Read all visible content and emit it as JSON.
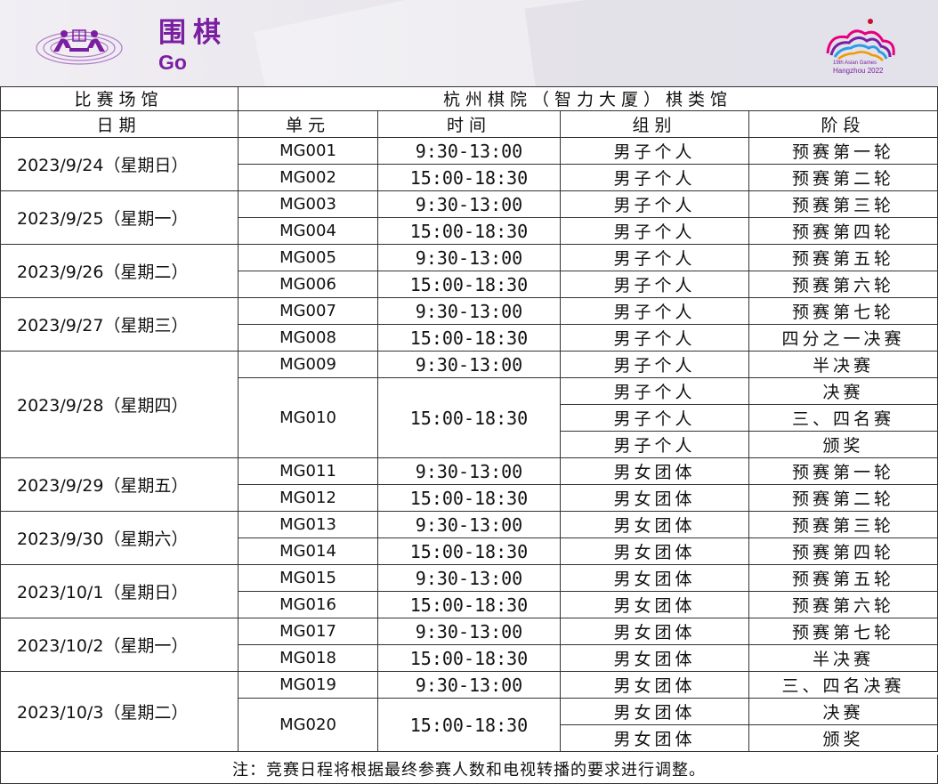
{
  "header": {
    "title_zh": "围棋",
    "title_en": "Go",
    "logo_caption_line1": "19th Asian Games",
    "logo_caption_line2": "Hangzhou 2022"
  },
  "venue": {
    "label": "比赛场馆",
    "name": "杭州棋院（智力大厦）棋类馆"
  },
  "columns": {
    "date": "日期",
    "unit": "单元",
    "time": "时间",
    "group": "组别",
    "phase": "阶段"
  },
  "days": [
    {
      "date": "2023/9/24（星期日）",
      "units": [
        {
          "code": "MG001",
          "time": "9:30-13:00",
          "events": [
            {
              "group": "男子个人",
              "phase": "预赛第一轮"
            }
          ]
        },
        {
          "code": "MG002",
          "time": "15:00-18:30",
          "events": [
            {
              "group": "男子个人",
              "phase": "预赛第二轮"
            }
          ]
        }
      ]
    },
    {
      "date": "2023/9/25（星期一）",
      "units": [
        {
          "code": "MG003",
          "time": "9:30-13:00",
          "events": [
            {
              "group": "男子个人",
              "phase": "预赛第三轮"
            }
          ]
        },
        {
          "code": "MG004",
          "time": "15:00-18:30",
          "events": [
            {
              "group": "男子个人",
              "phase": "预赛第四轮"
            }
          ]
        }
      ]
    },
    {
      "date": "2023/9/26（星期二）",
      "units": [
        {
          "code": "MG005",
          "time": "9:30-13:00",
          "events": [
            {
              "group": "男子个人",
              "phase": "预赛第五轮"
            }
          ]
        },
        {
          "code": "MG006",
          "time": "15:00-18:30",
          "events": [
            {
              "group": "男子个人",
              "phase": "预赛第六轮"
            }
          ]
        }
      ]
    },
    {
      "date": "2023/9/27（星期三）",
      "units": [
        {
          "code": "MG007",
          "time": "9:30-13:00",
          "events": [
            {
              "group": "男子个人",
              "phase": "预赛第七轮"
            }
          ]
        },
        {
          "code": "MG008",
          "time": "15:00-18:30",
          "events": [
            {
              "group": "男子个人",
              "phase": "四分之一决赛"
            }
          ]
        }
      ]
    },
    {
      "date": "2023/9/28（星期四）",
      "units": [
        {
          "code": "MG009",
          "time": "9:30-13:00",
          "events": [
            {
              "group": "男子个人",
              "phase": "半决赛"
            }
          ]
        },
        {
          "code": "MG010",
          "time": "15:00-18:30",
          "events": [
            {
              "group": "男子个人",
              "phase": "决赛"
            },
            {
              "group": "男子个人",
              "phase": "三、四名赛"
            },
            {
              "group": "男子个人",
              "phase": "颁奖"
            }
          ]
        }
      ]
    },
    {
      "date": "2023/9/29（星期五）",
      "units": [
        {
          "code": "MG011",
          "time": "9:30-13:00",
          "events": [
            {
              "group": "男女团体",
              "phase": "预赛第一轮"
            }
          ]
        },
        {
          "code": "MG012",
          "time": "15:00-18:30",
          "events": [
            {
              "group": "男女团体",
              "phase": "预赛第二轮"
            }
          ]
        }
      ]
    },
    {
      "date": "2023/9/30（星期六）",
      "units": [
        {
          "code": "MG013",
          "time": "9:30-13:00",
          "events": [
            {
              "group": "男女团体",
              "phase": "预赛第三轮"
            }
          ]
        },
        {
          "code": "MG014",
          "time": "15:00-18:30",
          "events": [
            {
              "group": "男女团体",
              "phase": "预赛第四轮"
            }
          ]
        }
      ]
    },
    {
      "date": "2023/10/1（星期日）",
      "units": [
        {
          "code": "MG015",
          "time": "9:30-13:00",
          "events": [
            {
              "group": "男女团体",
              "phase": "预赛第五轮"
            }
          ]
        },
        {
          "code": "MG016",
          "time": "15:00-18:30",
          "events": [
            {
              "group": "男女团体",
              "phase": "预赛第六轮"
            }
          ]
        }
      ]
    },
    {
      "date": "2023/10/2（星期一）",
      "units": [
        {
          "code": "MG017",
          "time": "9:30-13:00",
          "events": [
            {
              "group": "男女团体",
              "phase": "预赛第七轮"
            }
          ]
        },
        {
          "code": "MG018",
          "time": "15:00-18:30",
          "events": [
            {
              "group": "男女团体",
              "phase": "半决赛"
            }
          ]
        }
      ]
    },
    {
      "date": "2023/10/3（星期二）",
      "units": [
        {
          "code": "MG019",
          "time": "9:30-13:00",
          "events": [
            {
              "group": "男女团体",
              "phase": "三、四名决赛"
            }
          ]
        },
        {
          "code": "MG020",
          "time": "15:00-18:30",
          "events": [
            {
              "group": "男女团体",
              "phase": "决赛"
            },
            {
              "group": "男女团体",
              "phase": "颁奖"
            }
          ]
        }
      ]
    }
  ],
  "note": "注：竞赛日程将根据最终参赛人数和电视转播的要求进行调整。",
  "colors": {
    "accent": "#7b1fa2",
    "grid": "#333333"
  }
}
